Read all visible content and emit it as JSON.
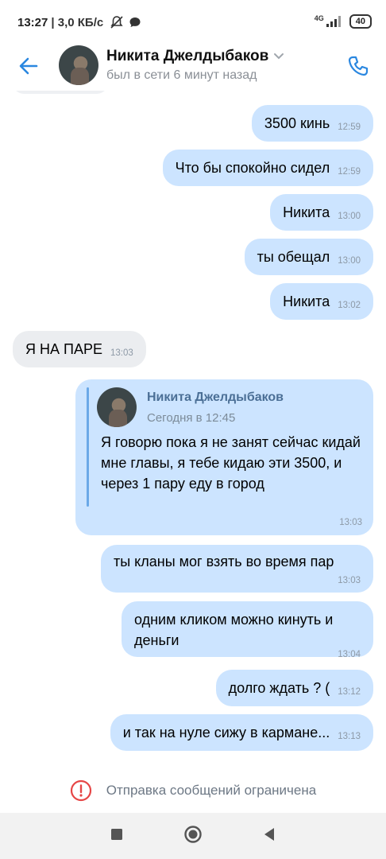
{
  "status_bar": {
    "time": "13:27",
    "speed": "| 3,0 КБ/с",
    "network": "4G",
    "battery": "40"
  },
  "header": {
    "name": "Никита Джелдыбаков",
    "last_seen": "был в сети 6 минут назад"
  },
  "messages": [
    {
      "dir": "out",
      "text": "3500 кинь",
      "time": "12:59"
    },
    {
      "dir": "out",
      "text": "Что бы спокойно сидел",
      "time": "12:59"
    },
    {
      "dir": "out",
      "text": "Никита",
      "time": "13:00"
    },
    {
      "dir": "out",
      "text": "ты обещал",
      "time": "13:00"
    },
    {
      "dir": "out",
      "text": "Никита",
      "time": "13:02"
    },
    {
      "dir": "in",
      "text": "Я НА ПАРЕ",
      "time": "13:03"
    },
    {
      "dir": "out",
      "text": "ты кланы мог взять во время пар",
      "time": "13:03"
    },
    {
      "dir": "out",
      "text": "одним кликом можно кинуть и деньги",
      "time": "13:04"
    },
    {
      "dir": "out",
      "text": "долго ждать ? (",
      "time": "13:12"
    },
    {
      "dir": "out",
      "text": "и так на нуле сижу в кармане...",
      "time": "13:13"
    }
  ],
  "forwarded": {
    "author": "Никита Джелдыбаков",
    "date": "Сегодня в 12:45",
    "text": "Я говорю пока я не занят сейчас кидай мне главы,   я тебе кидаю эти 3500, и через 1 пару еду в город",
    "time": "13:03"
  },
  "footer": {
    "restricted_text": "Отправка сообщений ограничена"
  },
  "colors": {
    "accent": "#2a87e0",
    "outgoing_bubble": "#cce4ff",
    "incoming_bubble": "#ebedf0",
    "warning": "#e64646"
  }
}
